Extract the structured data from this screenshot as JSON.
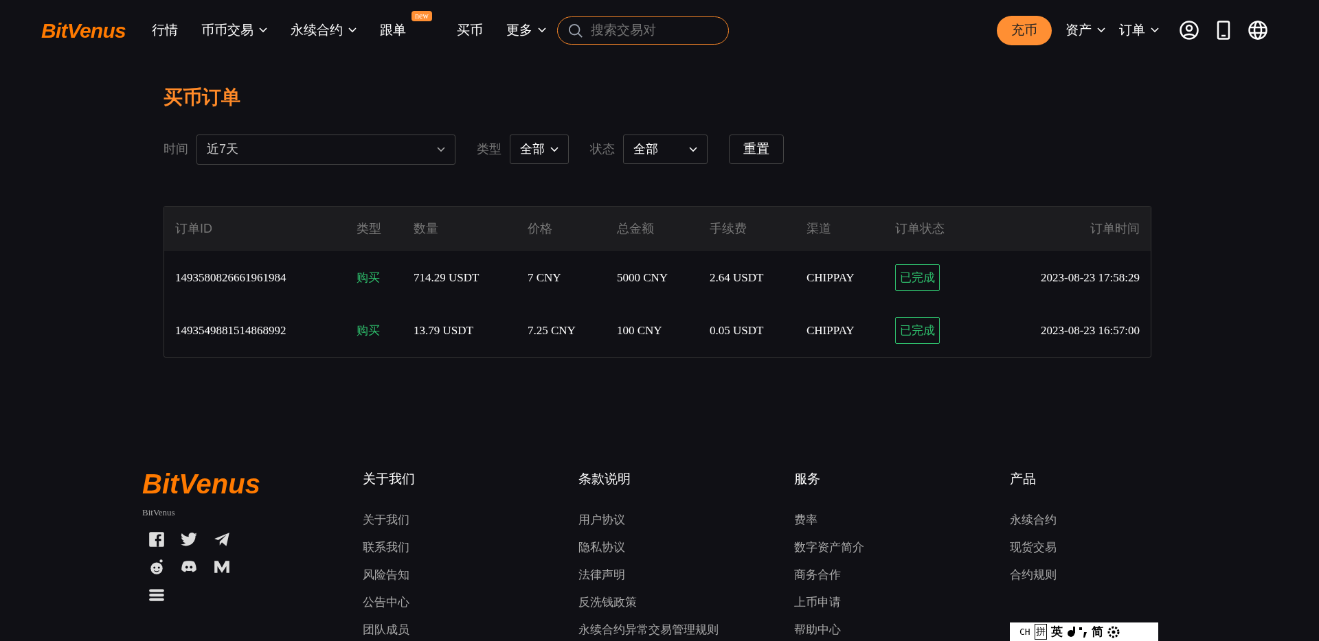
{
  "header": {
    "logo": "BitVenus",
    "nav": [
      {
        "label": "行情",
        "dropdown": false
      },
      {
        "label": "币币交易",
        "dropdown": true
      },
      {
        "label": "永续合约",
        "dropdown": true
      },
      {
        "label": "跟单",
        "dropdown": false,
        "badge": "new"
      },
      {
        "label": "买币",
        "dropdown": false
      },
      {
        "label": "更多",
        "dropdown": true
      }
    ],
    "search": {
      "placeholder": "搜索交易对"
    },
    "deposit_button": "充币",
    "right_menus": [
      "资产",
      "订单"
    ]
  },
  "page_title": "买币订单",
  "filters": [
    {
      "label": "时间",
      "value": "近7天",
      "kind": "wide"
    },
    {
      "label": "类型",
      "value": "全部",
      "kind": "narrow"
    },
    {
      "label": "状态",
      "value": "全部",
      "kind": "medium"
    }
  ],
  "reset_button": "重置",
  "table": {
    "columns": [
      "订单ID",
      "类型",
      "数量",
      "价格",
      "总金额",
      "手续费",
      "渠道",
      "订单状态",
      "订单时间"
    ],
    "rows": [
      {
        "id": "1493580826661961984",
        "type": "购买",
        "amount": "714.29 USDT",
        "price": "7 CNY",
        "total": "5000 CNY",
        "fee": "2.64 USDT",
        "channel": "CHIPPAY",
        "status": "已完成",
        "time": "2023-08-23 17:58:29"
      },
      {
        "id": "1493549881514868992",
        "type": "购买",
        "amount": "13.79 USDT",
        "price": "7.25 CNY",
        "total": "100 CNY",
        "fee": "0.05 USDT",
        "channel": "CHIPPAY",
        "status": "已完成",
        "time": "2023-08-23 16:57:00"
      }
    ]
  },
  "footer": {
    "logo": "BitVenus",
    "brand_caption": "BitVenus",
    "social": [
      {
        "kind": "facebook"
      },
      {
        "kind": "twitter"
      },
      {
        "kind": "telegram"
      },
      {
        "kind": "reddit"
      },
      {
        "kind": "discord"
      },
      {
        "kind": "medium"
      },
      {
        "kind": "other"
      }
    ],
    "columns": [
      {
        "heading": "关于我们",
        "links": [
          "关于我们",
          "联系我们",
          "风险告知",
          "公告中心",
          "团队成员"
        ]
      },
      {
        "heading": "条款说明",
        "links": [
          "用户协议",
          "隐私协议",
          "法律声明",
          "反洗钱政策",
          "永续合约异常交易管理规则"
        ]
      },
      {
        "heading": "服务",
        "links": [
          "费率",
          "数字资产简介",
          "商务合作",
          "上币申请",
          "帮助中心"
        ]
      },
      {
        "heading": "产品",
        "links": [
          "永续合约",
          "现货交易",
          "合约规则"
        ]
      }
    ]
  },
  "ime_toolbar": {
    "items": [
      "CH",
      "拼",
      "英",
      "简"
    ]
  }
}
